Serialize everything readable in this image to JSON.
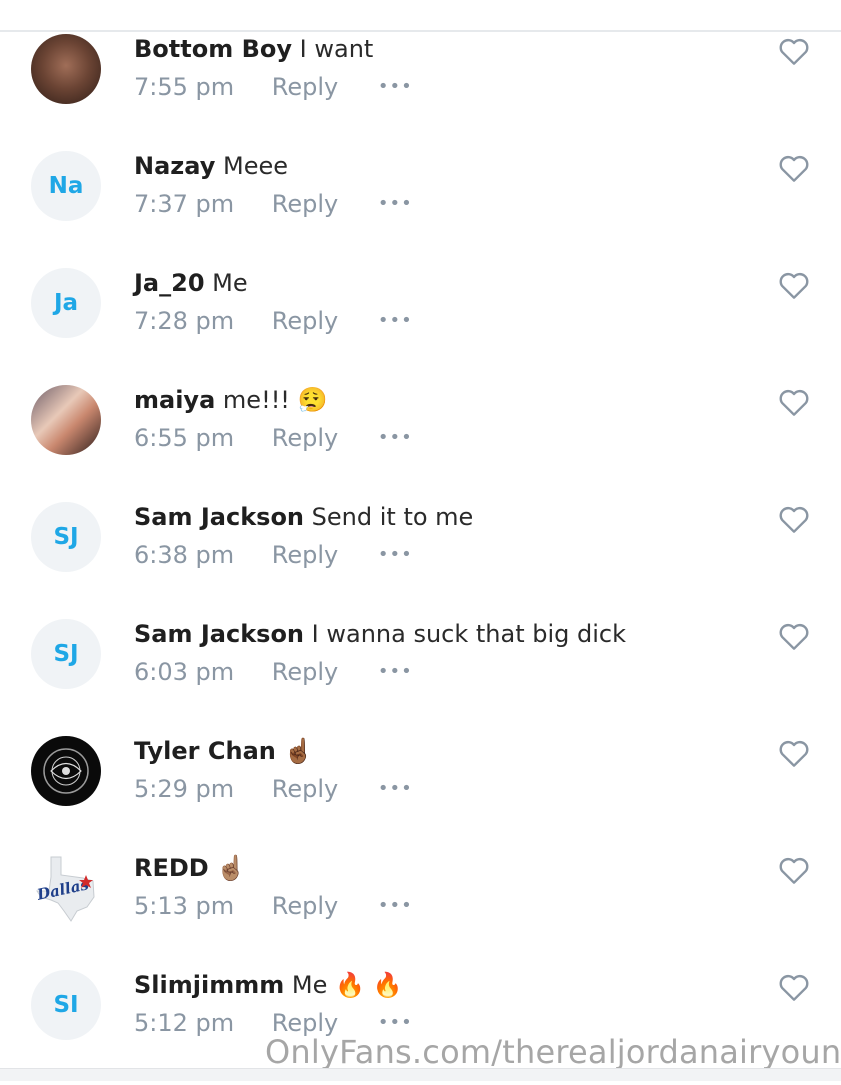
{
  "comments": [
    {
      "initials": "",
      "author": "Bottom Boy",
      "text": "I want",
      "emoji": "",
      "time": "7:55 pm",
      "reply": "Reply"
    },
    {
      "initials": "Na",
      "author": "Nazay",
      "text": "Meee",
      "emoji": "",
      "time": "7:37 pm",
      "reply": "Reply"
    },
    {
      "initials": "Ja",
      "author": "Ja_20",
      "text": "Me",
      "emoji": "",
      "time": "7:28 pm",
      "reply": "Reply"
    },
    {
      "initials": "",
      "author": "maiya",
      "text": "me!!!",
      "emoji": "😮‍💨",
      "time": "6:55 pm",
      "reply": "Reply"
    },
    {
      "initials": "SJ",
      "author": "Sam Jackson",
      "text": "Send it to me",
      "emoji": "",
      "time": "6:38 pm",
      "reply": "Reply"
    },
    {
      "initials": "SJ",
      "author": "Sam Jackson",
      "text": "I wanna suck that big dick",
      "emoji": "",
      "time": "6:03 pm",
      "reply": "Reply"
    },
    {
      "initials": "",
      "author": "Tyler Chan",
      "text": "",
      "emoji": "☝🏾",
      "time": "5:29 pm",
      "reply": "Reply"
    },
    {
      "initials": "",
      "author": "REDD",
      "text": "",
      "emoji": "☝🏽",
      "time": "5:13 pm",
      "reply": "Reply"
    },
    {
      "initials": "SI",
      "author": "Slimjimmm",
      "text": "Me",
      "emoji": "🔥 🔥",
      "time": "5:12 pm",
      "reply": "Reply"
    }
  ],
  "more_label": "•••",
  "avatar_logo_text": "Dallas",
  "watermark": "OnlyFans.com/therealjordanairyoung",
  "colors": {
    "accent": "#1fa7e6",
    "muted": "#8a96a3",
    "text": "#222222"
  }
}
